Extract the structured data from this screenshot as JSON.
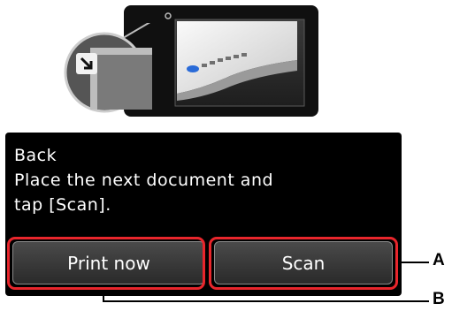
{
  "screen": {
    "message_lines": [
      "Back",
      "Place the next document and",
      "tap [Scan]."
    ]
  },
  "buttons": {
    "print_now_label": "Print now",
    "scan_label": "Scan"
  },
  "callouts": {
    "a_label": "A",
    "b_label": "B"
  },
  "colors": {
    "callout": "#e8262c",
    "screen_bg": "#000000",
    "button_text": "#ffffff"
  },
  "icons": {
    "illustration": "scanner-document-illustration",
    "zoom": "corner-arrow-zoom-icon"
  }
}
